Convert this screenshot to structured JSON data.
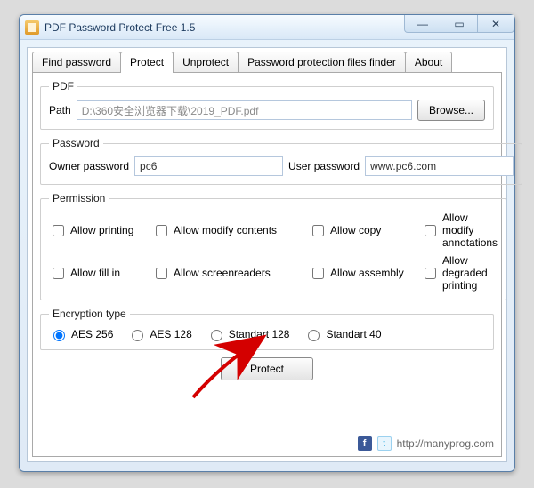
{
  "window": {
    "title": "PDF Password Protect Free 1.5"
  },
  "tabs": {
    "find": "Find password",
    "protect": "Protect",
    "unprotect": "Unprotect",
    "finder": "Password protection files finder",
    "about": "About"
  },
  "pdf": {
    "legend": "PDF",
    "path_label": "Path",
    "path_value": "D:\\360安全浏览器下载\\2019_PDF.pdf",
    "browse": "Browse..."
  },
  "password": {
    "legend": "Password",
    "owner_label": "Owner password",
    "owner_value": "pc6",
    "user_label": "User password",
    "user_value": "www.pc6.com"
  },
  "permission": {
    "legend": "Permission",
    "allow_printing": "Allow printing",
    "allow_modify_contents": "Allow modify contents",
    "allow_copy": "Allow copy",
    "allow_modify_annotations": "Allow modify annotations",
    "allow_fill_in": "Allow fill in",
    "allow_screenreaders": "Allow screenreaders",
    "allow_assembly": "Allow assembly",
    "allow_degraded_printing": "Allow degraded printing"
  },
  "encryption": {
    "legend": "Encryption type",
    "aes256": "AES 256",
    "aes128": "AES 128",
    "std128": "Standart 128",
    "std40": "Standart 40"
  },
  "actions": {
    "protect": "Protect"
  },
  "footer": {
    "url": "http://manyprog.com"
  }
}
